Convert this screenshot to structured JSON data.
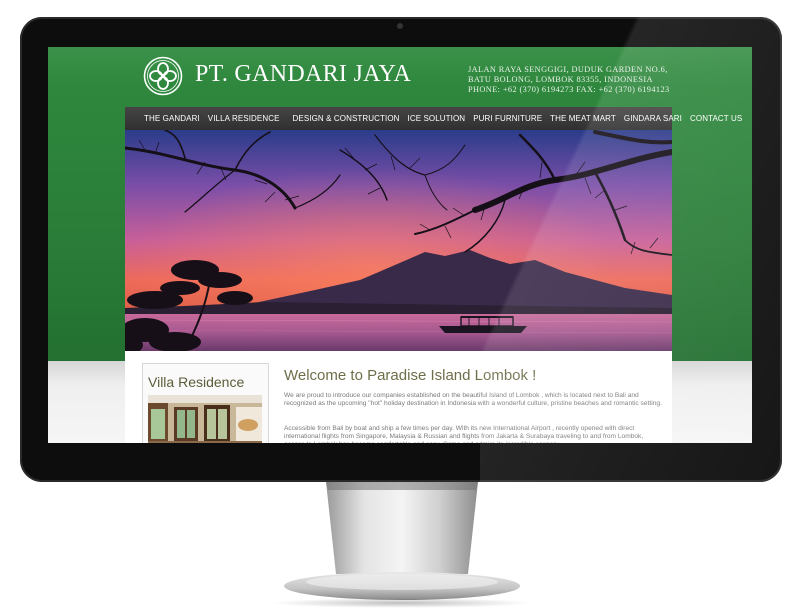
{
  "brand": {
    "name": "PT. GANDARI JAYA",
    "logo_icon": "celtic-knot-icon"
  },
  "contact": {
    "address_line1": "JALAN RAYA SENGGIGI, DUDUK GARDEN NO.6,",
    "address_line2": "BATU BOLONG, LOMBOK 83355, INDONESIA",
    "phone_line": "PHONE: +62 (370) 6194273 FAX: +62 (370) 6194123"
  },
  "nav": {
    "items": [
      {
        "label": "THE GANDARI"
      },
      {
        "label": "VILLA RESIDENCE"
      },
      {
        "label": "DESIGN & CONSTRUCTION"
      },
      {
        "label": "ICE SOLUTION"
      },
      {
        "label": "PURI FURNITURE"
      },
      {
        "label": "THE MEAT MART"
      },
      {
        "label": "GINDARA SARI"
      },
      {
        "label": "CONTACT US"
      }
    ]
  },
  "sidebar": {
    "title": "Villa Residence"
  },
  "main": {
    "title": "Welcome to Paradise Island Lombok !",
    "paragraph1": "We are proud to introduce our companies established on the beautiful Island of Lombok , which is located next to Bali and recognized as the upcoming \"hot\" holiday destination in Indonesia with a wonderful culture, pristine beaches and romantic setting.",
    "paragraph2": "Accessible from Bali by boat and ship a few times per day. With its new International Airport , recently opened with direct international flights from Singapore, Malaysia & Russian and flights from Jakarta & Surabaya traveling to and from Lombok, access to Lombok has become comfortable and easy. Come and admire its incredible scenery."
  },
  "colors": {
    "header_green": "#2a7d38",
    "nav_bg": "#3a3a3a",
    "title_olive": "#6e6e4a"
  }
}
